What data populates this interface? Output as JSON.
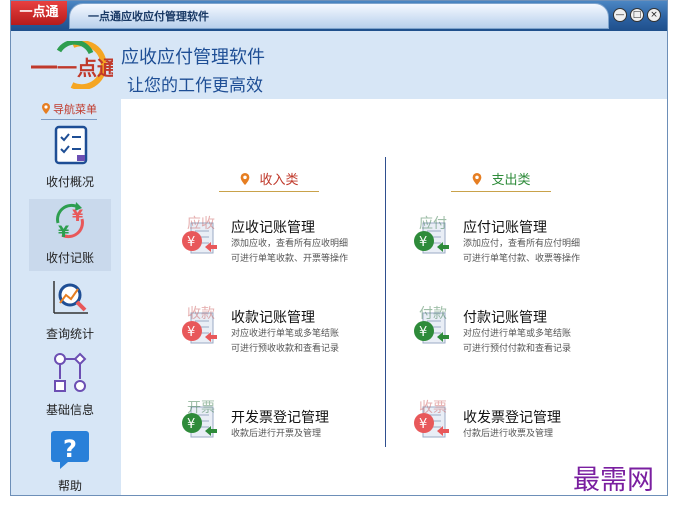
{
  "window": {
    "app_tab": "一点通",
    "title": "一点通应收应付管理软件",
    "controls": [
      "—",
      "□",
      "×"
    ]
  },
  "header": {
    "logo_text": "一点通",
    "title_line1": "应收应付管理软件",
    "title_line2": "让您的工作更高效"
  },
  "sidebar": {
    "nav_title": "导航菜单",
    "items": [
      {
        "label": "收付概况",
        "icon": "checklist-icon"
      },
      {
        "label": "收付记账",
        "icon": "yuan-exchange-icon"
      },
      {
        "label": "查询统计",
        "icon": "chart-magnifier-icon"
      },
      {
        "label": "基础信息",
        "icon": "flowchart-icon"
      },
      {
        "label": "帮助",
        "icon": "help-icon"
      }
    ]
  },
  "income": {
    "category": "收入类",
    "entries": [
      {
        "ghost": "应收",
        "title": "应收记账管理",
        "desc1": "添加应收，查看所有应收明细",
        "desc2": "可进行单笔收款、开票等操作"
      },
      {
        "ghost": "收款",
        "title": "收款记账管理",
        "desc1": "对应收进行单笔或多笔结账",
        "desc2": "可进行预收收款和查看记录"
      },
      {
        "ghost": "开票",
        "title": "开发票登记管理",
        "desc1": "收款后进行开票及管理",
        "desc2": ""
      }
    ]
  },
  "expense": {
    "category": "支出类",
    "entries": [
      {
        "ghost": "应付",
        "title": "应付记账管理",
        "desc1": "添加应付，查看所有应付明细",
        "desc2": "可进行单笔付款、收票等操作"
      },
      {
        "ghost": "付款",
        "title": "付款记账管理",
        "desc1": "对应付进行单笔或多笔结账",
        "desc2": "可进行预付付款和查看记录"
      },
      {
        "ghost": "收票",
        "title": "收发票登记管理",
        "desc1": "付款后进行收票及管理",
        "desc2": ""
      }
    ]
  },
  "watermark": "最需网",
  "colors": {
    "primary_blue": "#1e4e95",
    "income_red": "#e8585a",
    "expense_green": "#2e8b3a",
    "accent_orange": "#f39c12"
  }
}
